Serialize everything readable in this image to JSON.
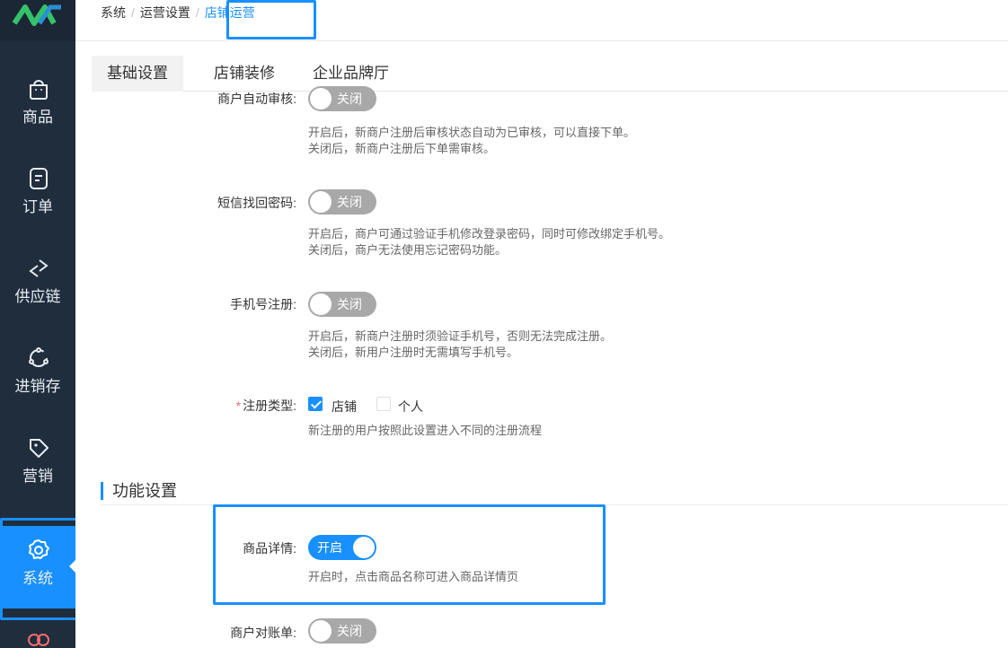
{
  "breadcrumb": {
    "items": [
      "系统",
      "运营设置",
      "店铺运营"
    ]
  },
  "sidebar": {
    "items": [
      {
        "label": "商品",
        "icon": "bag-icon"
      },
      {
        "label": "订单",
        "icon": "order-icon"
      },
      {
        "label": "供应链",
        "icon": "arrows-exchange-icon"
      },
      {
        "label": "进销存",
        "icon": "cycle-icon"
      },
      {
        "label": "营销",
        "icon": "tag-icon"
      },
      {
        "label": "系统",
        "icon": "gear-icon",
        "active": true
      }
    ]
  },
  "tabs": [
    {
      "label": "基础设置",
      "active": true
    },
    {
      "label": "店铺装修"
    },
    {
      "label": "企业品牌厅"
    }
  ],
  "settings": {
    "auto_review": {
      "label": "商户自动审核:",
      "switch": "关闭",
      "desc1": "开启后，新商户注册后审核状态自动为已审核，可以直接下单。",
      "desc2": "关闭后，新商户注册后下单需审核。"
    },
    "sms_password": {
      "label": "短信找回密码:",
      "switch": "关闭",
      "desc1": "开启后，商户可通过验证手机修改登录密码，同时可修改绑定手机号。",
      "desc2": "关闭后，商户无法使用忘记密码功能。"
    },
    "phone_register": {
      "label": "手机号注册:",
      "switch": "关闭",
      "desc1": "开启后，新商户注册时须验证手机号，否则无法完成注册。",
      "desc2": "关闭后，新用户注册时无需填写手机号。"
    },
    "register_type": {
      "required_mark": "*",
      "label": "注册类型:",
      "options": [
        {
          "label": "店铺",
          "checked": true
        },
        {
          "label": "个人",
          "checked": false
        }
      ],
      "desc": "新注册的用户按照此设置进入不同的注册流程"
    }
  },
  "function_section": {
    "title": "功能设置",
    "product_detail": {
      "label": "商品详情:",
      "switch": "开启",
      "desc": "开启时，点击商品名称可进入商品详情页"
    },
    "merchant_statement": {
      "label": "商户对账单:",
      "switch": "关闭"
    }
  },
  "colors": {
    "accent": "#1890ff",
    "sidebar_bg": "#1f2d3d",
    "switch_off": "#a8a8a8"
  }
}
